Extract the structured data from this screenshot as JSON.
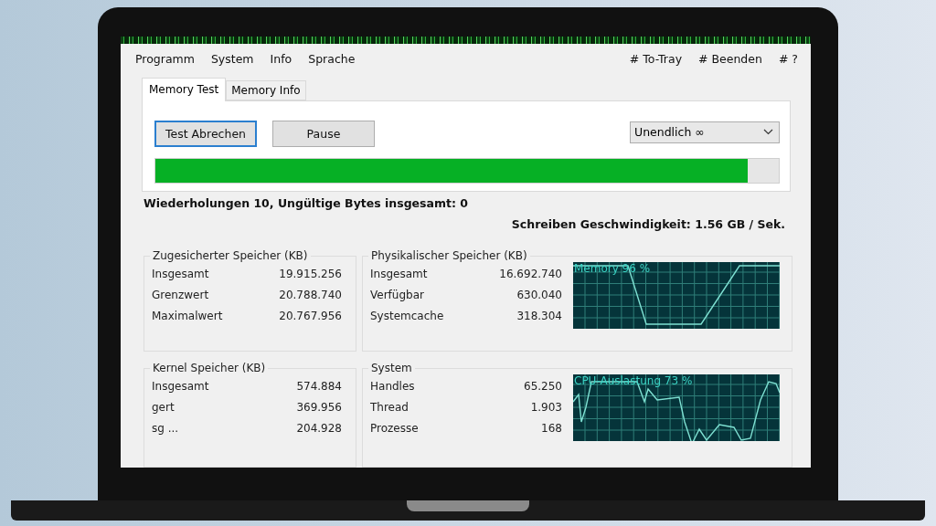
{
  "menu": {
    "left": [
      "Programm",
      "System",
      "Info",
      "Sprache"
    ],
    "right": [
      "# To-Tray",
      "# Beenden",
      "# ?"
    ]
  },
  "tabs": [
    {
      "label": "Memory Test",
      "selected": true
    },
    {
      "label": "Memory Info",
      "selected": false
    }
  ],
  "buttons": [
    {
      "label": "Test Abrechen",
      "focused": true
    },
    {
      "label": "Pause",
      "focused": false
    }
  ],
  "mode_select": {
    "value": "Unendlich  ∞"
  },
  "progress": {
    "level": 0.95
  },
  "status": "Wiederholungen 10, Ungültige Bytes insgesamt: 0",
  "speed": "Schreiben Geschwindigkeit: 1.56 GB / Sek.",
  "groups": [
    {
      "title": "Zugesicherter Speicher (KB)",
      "rows": [
        {
          "label": "Insgesamt",
          "value": "19.915.256"
        },
        {
          "label": "Grenzwert",
          "value": "20.788.740"
        },
        {
          "label": "Maximalwert",
          "value": "20.767.956"
        }
      ]
    },
    {
      "title": "Physikalischer Speicher (KB)",
      "rows": [
        {
          "label": "Insgesamt",
          "value": "16.692.740"
        },
        {
          "label": "Verfügbar",
          "value": "630.040"
        },
        {
          "label": "Systemcache",
          "value": "318.304"
        }
      ],
      "graph": {
        "kind": "memory",
        "label": "Memory 96 %"
      }
    },
    {
      "title": "Kernel Speicher (KB)",
      "rows": [
        {
          "label": "Insgesamt",
          "value": "574.884"
        },
        {
          "label": "gert",
          "value": "369.956"
        },
        {
          "label": "sg ...",
          "value": "204.928"
        }
      ]
    },
    {
      "title": "System",
      "rows": [
        {
          "label": "Handles",
          "value": "65.250"
        },
        {
          "label": "Thread",
          "value": "1.903"
        },
        {
          "label": "Prozesse",
          "value": "168"
        }
      ],
      "graph": {
        "kind": "cpu",
        "label": "CPU-Auslastung 73 %"
      }
    }
  ]
}
